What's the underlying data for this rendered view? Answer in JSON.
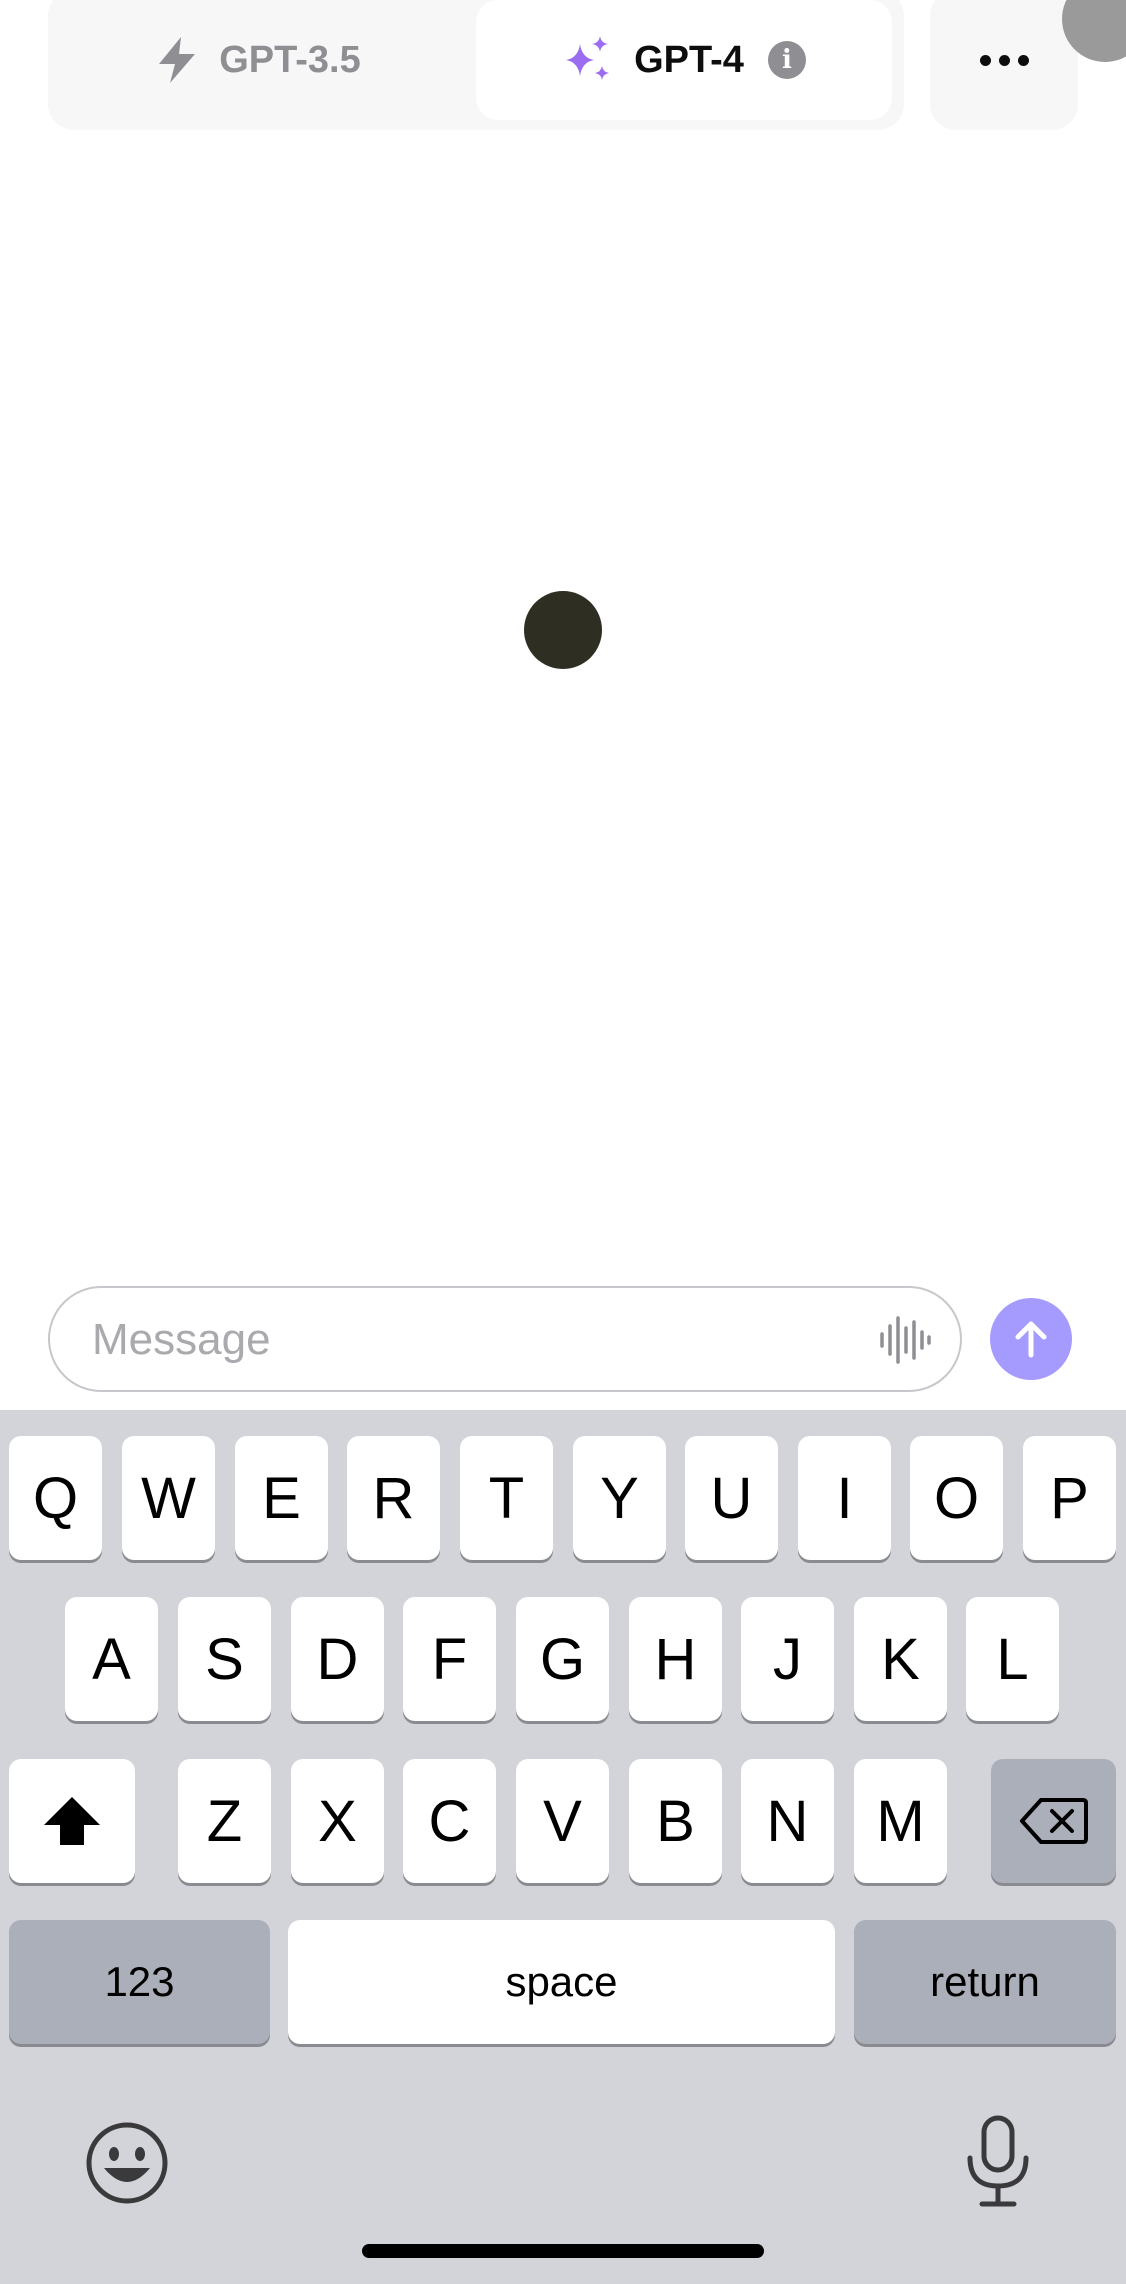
{
  "model_switcher": {
    "gpt35_label": "GPT-3.5",
    "gpt4_label": "GPT-4",
    "selected": "GPT-4",
    "info_glyph": "i",
    "icons": {
      "gpt35": "lightning-bolt-icon",
      "gpt4": "sparkles-icon",
      "info": "info-icon"
    },
    "gpt4_icon_color": "#9b6df0"
  },
  "header": {
    "more_icon": "ellipsis-icon",
    "avatar": "user-avatar"
  },
  "composer": {
    "placeholder": "Message",
    "value": "",
    "voice_icon": "audio-waveform-icon",
    "send_icon": "arrow-up-icon",
    "send_color": "#a59bff"
  },
  "keyboard": {
    "row1": [
      "Q",
      "W",
      "E",
      "R",
      "T",
      "Y",
      "U",
      "I",
      "O",
      "P"
    ],
    "row2": [
      "A",
      "S",
      "D",
      "F",
      "G",
      "H",
      "J",
      "K",
      "L"
    ],
    "row3": [
      "Z",
      "X",
      "C",
      "V",
      "B",
      "N",
      "M"
    ],
    "shift_icon": "shift-arrow-icon",
    "delete_icon": "backspace-icon",
    "numbers_label": "123",
    "space_label": "space",
    "return_label": "return",
    "emoji_icon": "emoji-icon",
    "dictation_icon": "microphone-icon"
  }
}
